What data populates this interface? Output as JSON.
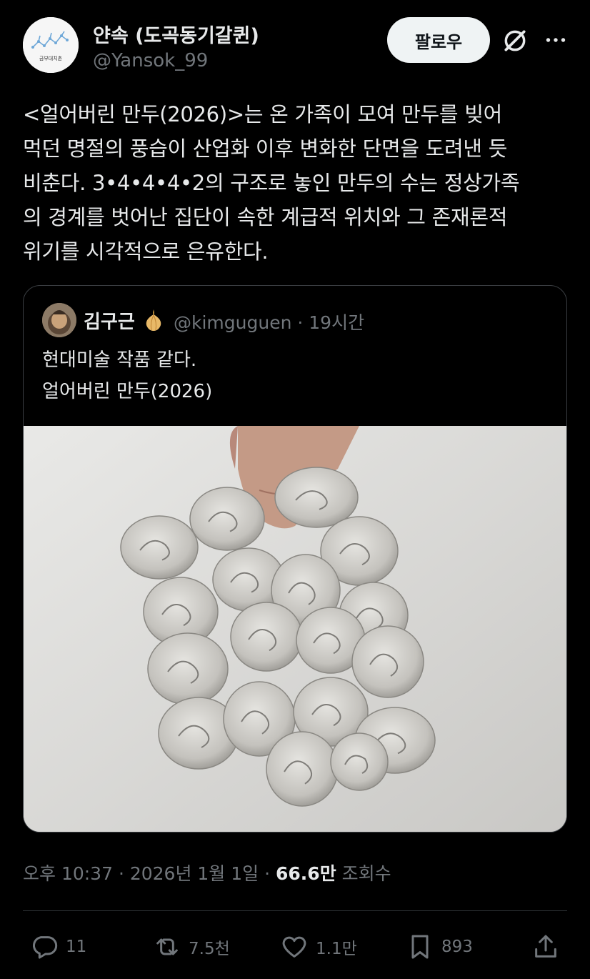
{
  "author": {
    "name": "얀속 (도곡동기갈퀸)",
    "handle": "@Yansok_99",
    "avatar_caption": "금부대치촌"
  },
  "header": {
    "follow_label": "팔로우",
    "icons": [
      "grok-icon",
      "more-icon"
    ]
  },
  "tweet": {
    "lines": [
      "<얼어버린 만두(2026)>는 온 가족이 모여 만두를 빚어",
      "먹던 명절의 풍습이 산업화 이후 변화한 단면을 도려낸 듯",
      "비춘다. 3•4•4•4•2의 구조로 놓인 만두의 수는 정상가족",
      "의 경계를 벗어난 집단이 속한 계급적 위치와 그 존재론적",
      "위기를 시각적으로 은유한다."
    ]
  },
  "quote": {
    "name": "김구근",
    "handle_time": "@kimguguen · 19시간",
    "lines": [
      "현대미술 작품 같다.",
      "얼어버린 만두(2026)"
    ]
  },
  "meta": {
    "timestamp": "오후 10:37 · 2026년 1월 1일 · ",
    "views_num": "66.6만",
    "views_label": " 조회수"
  },
  "actions": {
    "replies": "11",
    "reposts": "7.5천",
    "likes": "1.1만",
    "bookmarks": "893"
  },
  "colors": {
    "background": "#000000",
    "text": "#e7e9ea",
    "muted": "#71767b",
    "button_bg": "#eff3f4"
  }
}
